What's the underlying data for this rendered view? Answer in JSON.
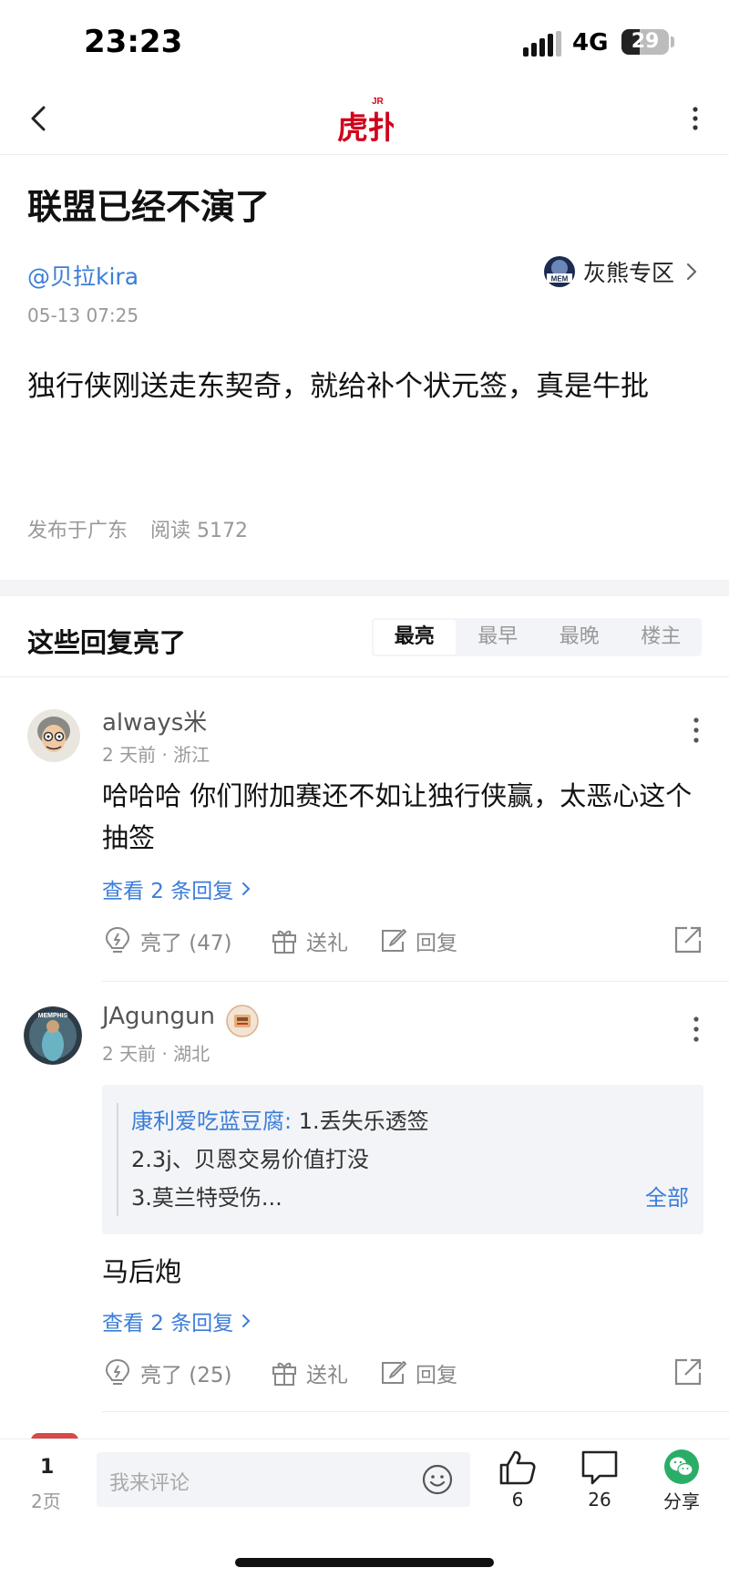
{
  "status": {
    "time": "23:23",
    "network": "4G",
    "battery": "29"
  },
  "nav": {
    "logo_text": "虎扑",
    "logo_badge": "JR"
  },
  "post": {
    "title": "联盟已经不演了",
    "author": "@贝拉kira",
    "zone": "灰熊专区",
    "zone_badge": "MEM",
    "date": "05-13 07:25",
    "body": "独行侠刚送走东契奇，就给补个状元签，真是牛批",
    "location": "发布于广东",
    "reads": "阅读 5172"
  },
  "replies_section": {
    "title": "这些回复亮了",
    "sort_options": [
      "最亮",
      "最早",
      "最晚",
      "楼主"
    ],
    "active_sort": "最亮"
  },
  "replies": [
    {
      "username": "always米",
      "time_loc": "2 天前 · 浙江",
      "content": "哈哈哈  你们附加赛还不如让独行侠赢，太恶心这个抽签",
      "view_replies": "查看 2 条回复",
      "likes": "亮了 (47)",
      "gift": "送礼",
      "reply": "回复"
    },
    {
      "username": "JAgungun",
      "time_loc": "2 天前 · 湖北",
      "quote_name": "康利爱吃蓝豆腐:",
      "quote_line1": " 1.丢失乐透签",
      "quote_line2": "2.3j、贝恩交易价值打没",
      "quote_line3": "3.莫兰特受伤...",
      "quote_all": "全部",
      "content": "马后炮",
      "view_replies": "查看 2 条回复",
      "likes": "亮了 (25)",
      "gift": "送礼",
      "reply": "回复"
    }
  ],
  "bottom_bar": {
    "page": "1",
    "pages": "2页",
    "comment_placeholder": "我来评论",
    "likes_count": "6",
    "comments_count": "26",
    "share_label": "分享"
  },
  "colors": {
    "link_blue": "#3b7dd8",
    "brand_red": "#d0021b",
    "wechat_green": "#2aae67"
  }
}
